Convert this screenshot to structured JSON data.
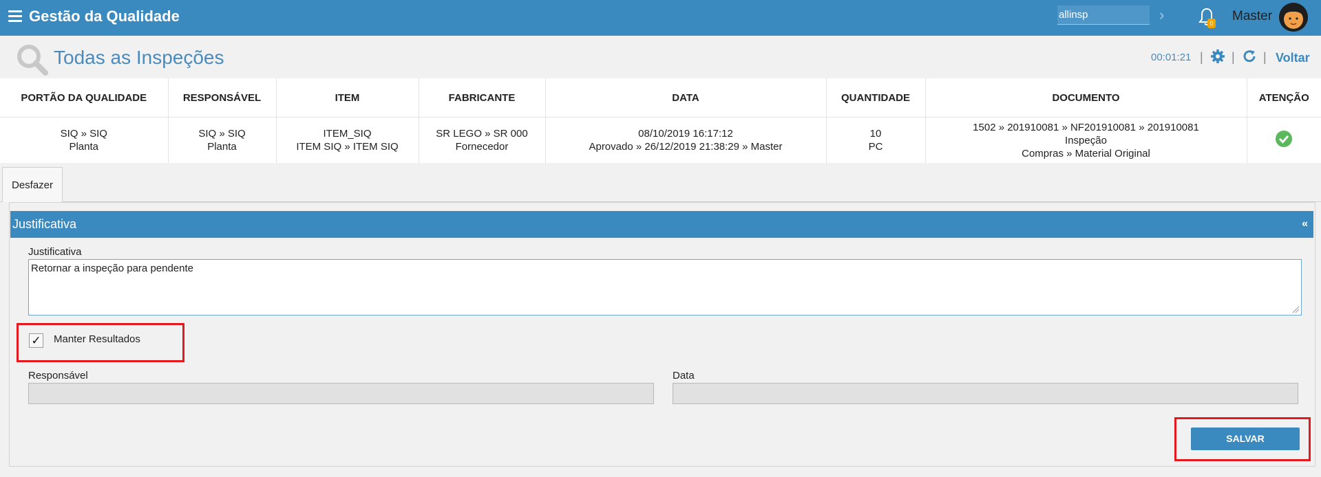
{
  "header": {
    "app_title": "Gestão da Qualidade",
    "search_value": "allinsp",
    "notification_count": "0",
    "user_name": "Master"
  },
  "page": {
    "title": "Todas as Inspeções",
    "timer": "00:01:21",
    "back_label": "Voltar"
  },
  "info_table": {
    "headers": [
      "PORTÃO DA QUALIDADE",
      "RESPONSÁVEL",
      "ITEM",
      "FABRICANTE",
      "DATA",
      "QUANTIDADE",
      "DOCUMENTO",
      "ATENÇÃO"
    ],
    "row": {
      "portao": [
        "SIQ » SIQ",
        "Planta"
      ],
      "responsavel": [
        "SIQ » SIQ",
        "Planta"
      ],
      "item": [
        "ITEM_SIQ",
        "ITEM SIQ » ITEM SIQ"
      ],
      "fabricante": [
        "SR LEGO » SR 000",
        "Fornecedor"
      ],
      "data": [
        "08/10/2019 16:17:12",
        "Aprovado » 26/12/2019 21:38:29 » Master"
      ],
      "quantidade": [
        "10",
        "PC"
      ],
      "documento": [
        "1502 » 201910081 » NF201910081 » 201910081",
        "Inspeção",
        "Compras » Material Original"
      ],
      "atencao_icon": "check-circle-icon"
    }
  },
  "tabs": [
    {
      "label": "Desfazer"
    }
  ],
  "panel": {
    "title": "Justificativa",
    "collapse_symbol": "«",
    "justificativa_label": "Justificativa",
    "justificativa_value": "Retornar a inspeção para pendente",
    "manter_resultados_label": "Manter Resultados",
    "manter_resultados_checked": true,
    "check_mark": "✓",
    "responsavel_label": "Responsável",
    "responsavel_value": "",
    "data_label": "Data",
    "data_value": "",
    "save_label": "SALVAR"
  },
  "colors": {
    "primary": "#3a8abf",
    "highlight": "#e4191e",
    "success": "#5cb85c"
  }
}
